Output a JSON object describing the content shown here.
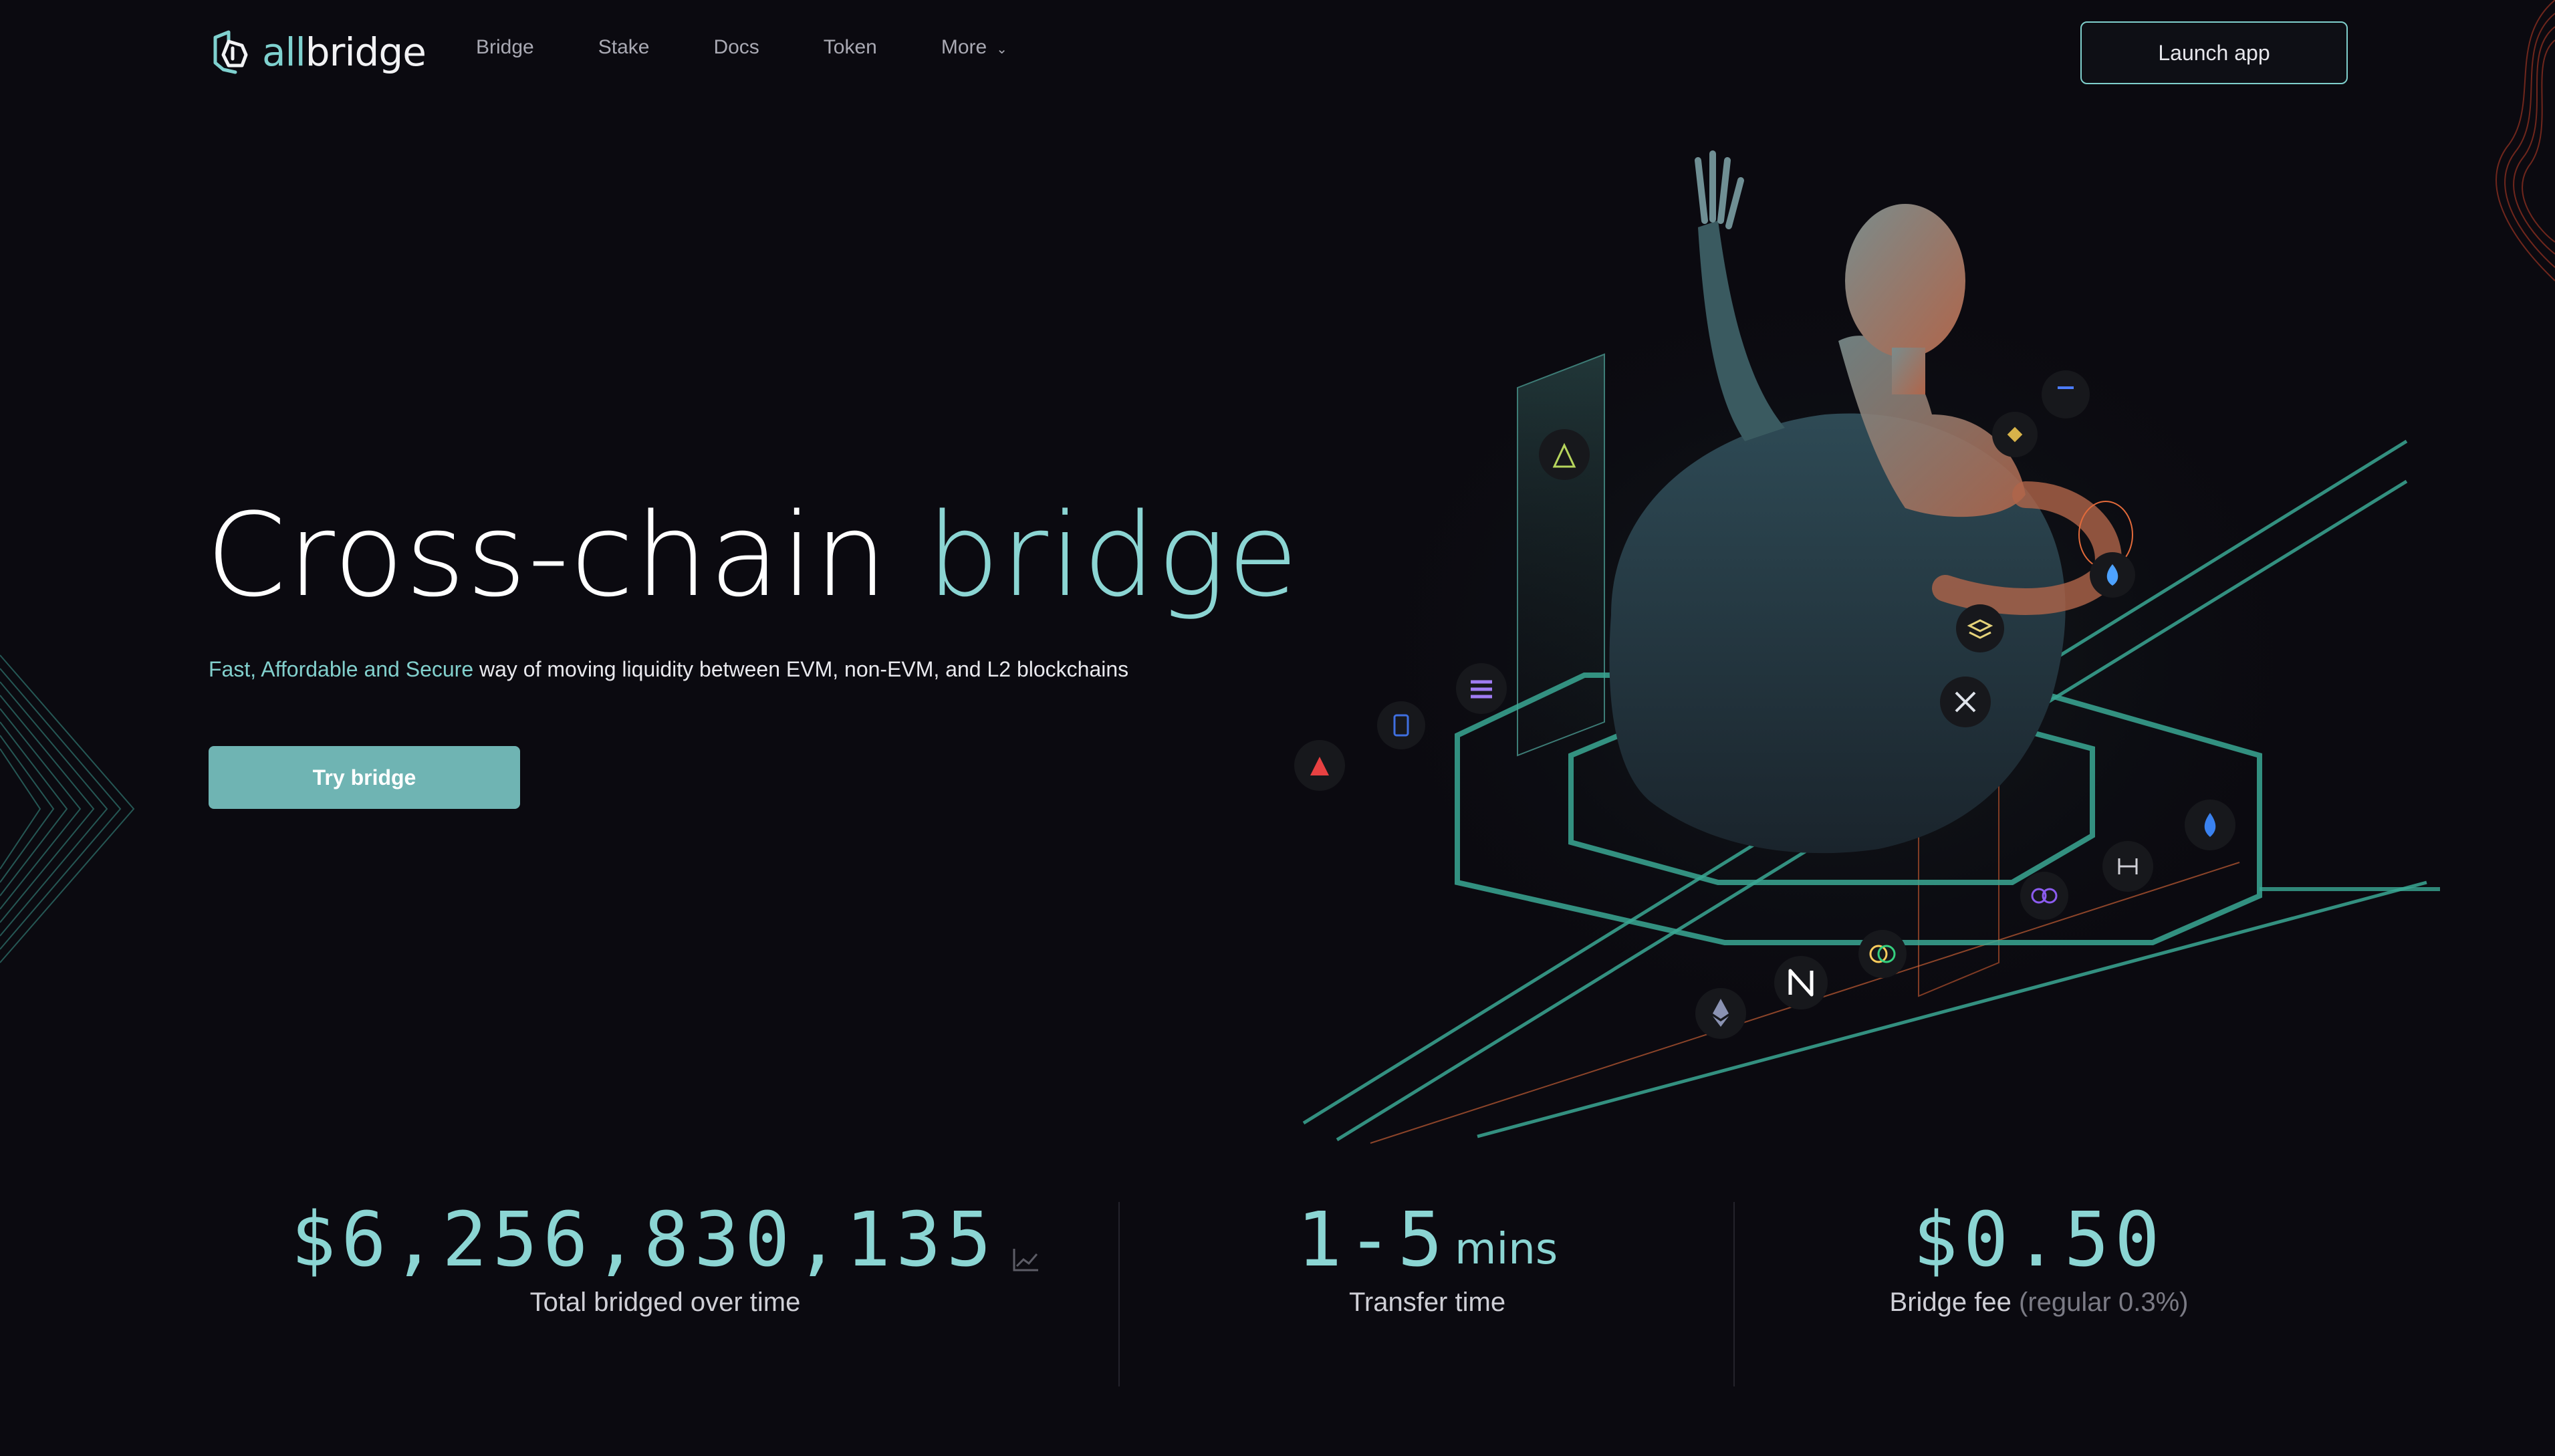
{
  "brand": {
    "logo_text_accent": "all",
    "logo_text_main": "bridge"
  },
  "nav": {
    "items": [
      {
        "label": "Bridge"
      },
      {
        "label": "Stake"
      },
      {
        "label": "Docs"
      },
      {
        "label": "Token"
      },
      {
        "label": "More",
        "has_dropdown": true
      }
    ],
    "launch_label": "Launch app"
  },
  "hero": {
    "title_part1": "Cross-chain",
    "title_part2": "bridge",
    "subtitle_highlight": "Fast, Affordable and Secure",
    "subtitle_rest": " way of moving liquidity between EVM, non-EVM, and L2 blockchains",
    "cta_label": "Try bridge"
  },
  "stats": [
    {
      "value": "$6,256,830,135",
      "label": "Total bridged over time",
      "icon": "trend-chart-icon"
    },
    {
      "value": "1-5",
      "unit": "mins",
      "label": "Transfer time"
    },
    {
      "value": "$0.50",
      "label": "Bridge fee",
      "label_muted": "(regular 0.3%)"
    }
  ],
  "chain_icons": [
    "tron-icon",
    "tezos-icon",
    "bnb-icon",
    "sui-icon",
    "solana-icon",
    "fantom-icon",
    "avalanche-icon",
    "stellar-icon",
    "chainlink-icon",
    "polygon-icon",
    "near-icon",
    "ethereum-icon",
    "celo-icon",
    "hedera-icon",
    "base-icon"
  ],
  "colors": {
    "background": "#0b0a10",
    "accent": "#8bd5d3",
    "button": "#6fb4b3",
    "line_teal": "#3aa894",
    "line_orange": "#e26a3a"
  }
}
